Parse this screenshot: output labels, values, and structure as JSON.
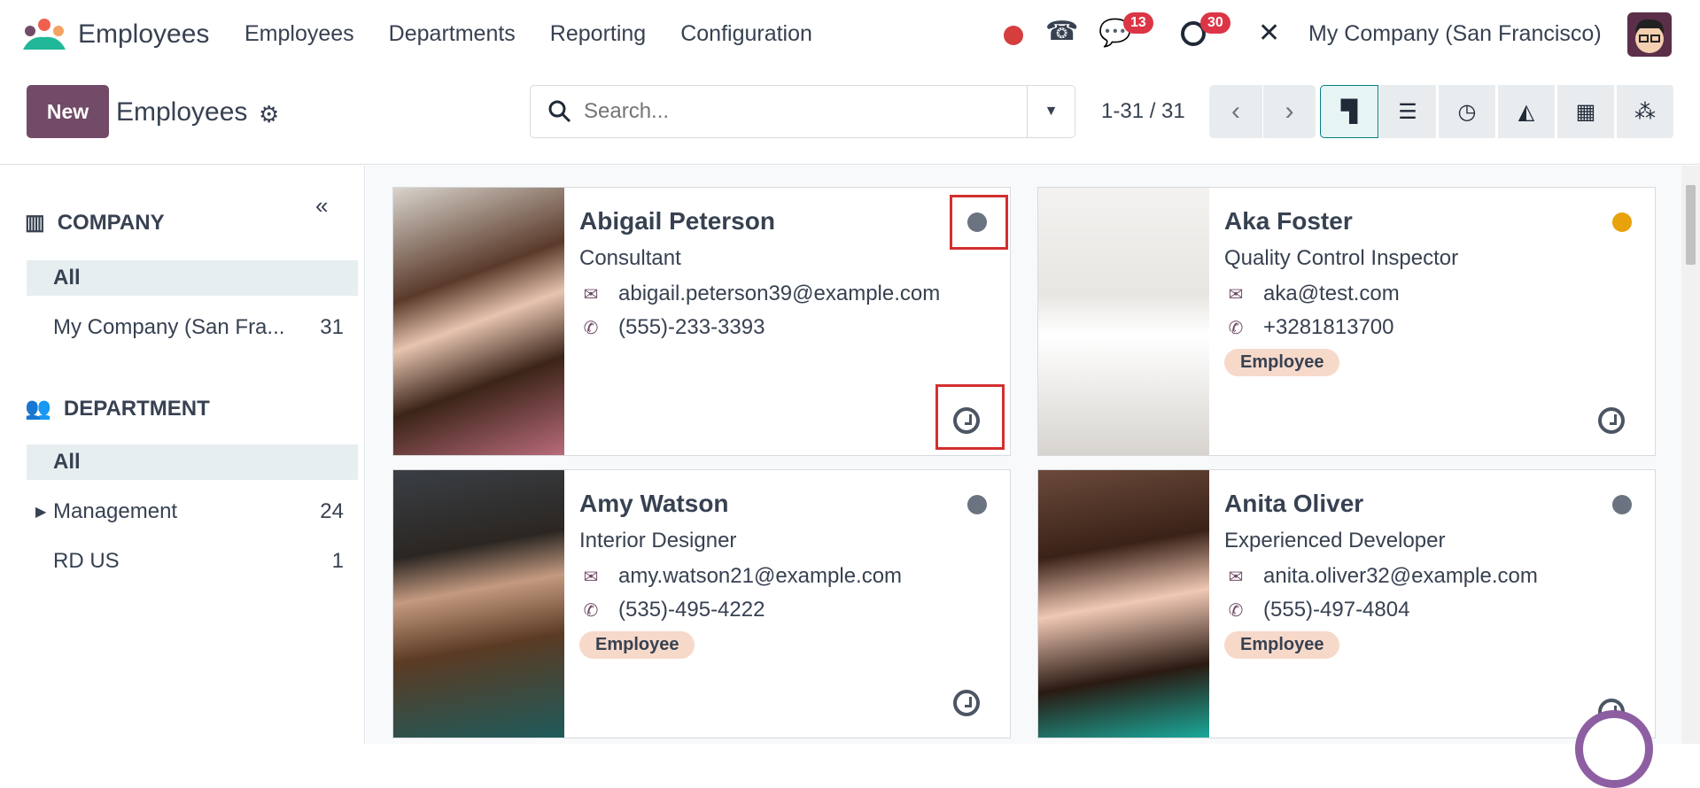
{
  "nav": {
    "app_name": "Employees",
    "menu": [
      "Employees",
      "Departments",
      "Reporting",
      "Configuration"
    ],
    "messages_count": "13",
    "activities_count": "30",
    "company": "My Company (San Francisco)"
  },
  "control": {
    "new_label": "New",
    "title": "Employees",
    "search_placeholder": "Search...",
    "pager": "1-31 / 31"
  },
  "sidebar": {
    "company_header": "COMPANY",
    "company_items": [
      {
        "label": "All",
        "count": ""
      },
      {
        "label": "My Company (San Fra...",
        "count": "31"
      }
    ],
    "department_header": "DEPARTMENT",
    "department_items": [
      {
        "label": "All",
        "count": ""
      },
      {
        "label": "Management",
        "count": "24"
      },
      {
        "label": "RD US",
        "count": "1"
      }
    ]
  },
  "employees": [
    {
      "name": "Abigail Peterson",
      "job": "Consultant",
      "email": "abigail.peterson39@example.com",
      "phone": "(555)-233-3393",
      "tag": "",
      "status_color": "#6b7280"
    },
    {
      "name": "Aka Foster",
      "job": "Quality Control Inspector",
      "email": "aka@test.com",
      "phone": "+3281813700",
      "tag": "Employee",
      "status_color": "#e8a20b"
    },
    {
      "name": "Amy Watson",
      "job": "Interior Designer",
      "email": "amy.watson21@example.com",
      "phone": "(535)-495-4222",
      "tag": "Employee",
      "status_color": "#6b7280"
    },
    {
      "name": "Anita Oliver",
      "job": "Experienced Developer",
      "email": "anita.oliver32@example.com",
      "phone": "(555)-497-4804",
      "tag": "Employee",
      "status_color": "#6b7280"
    }
  ]
}
